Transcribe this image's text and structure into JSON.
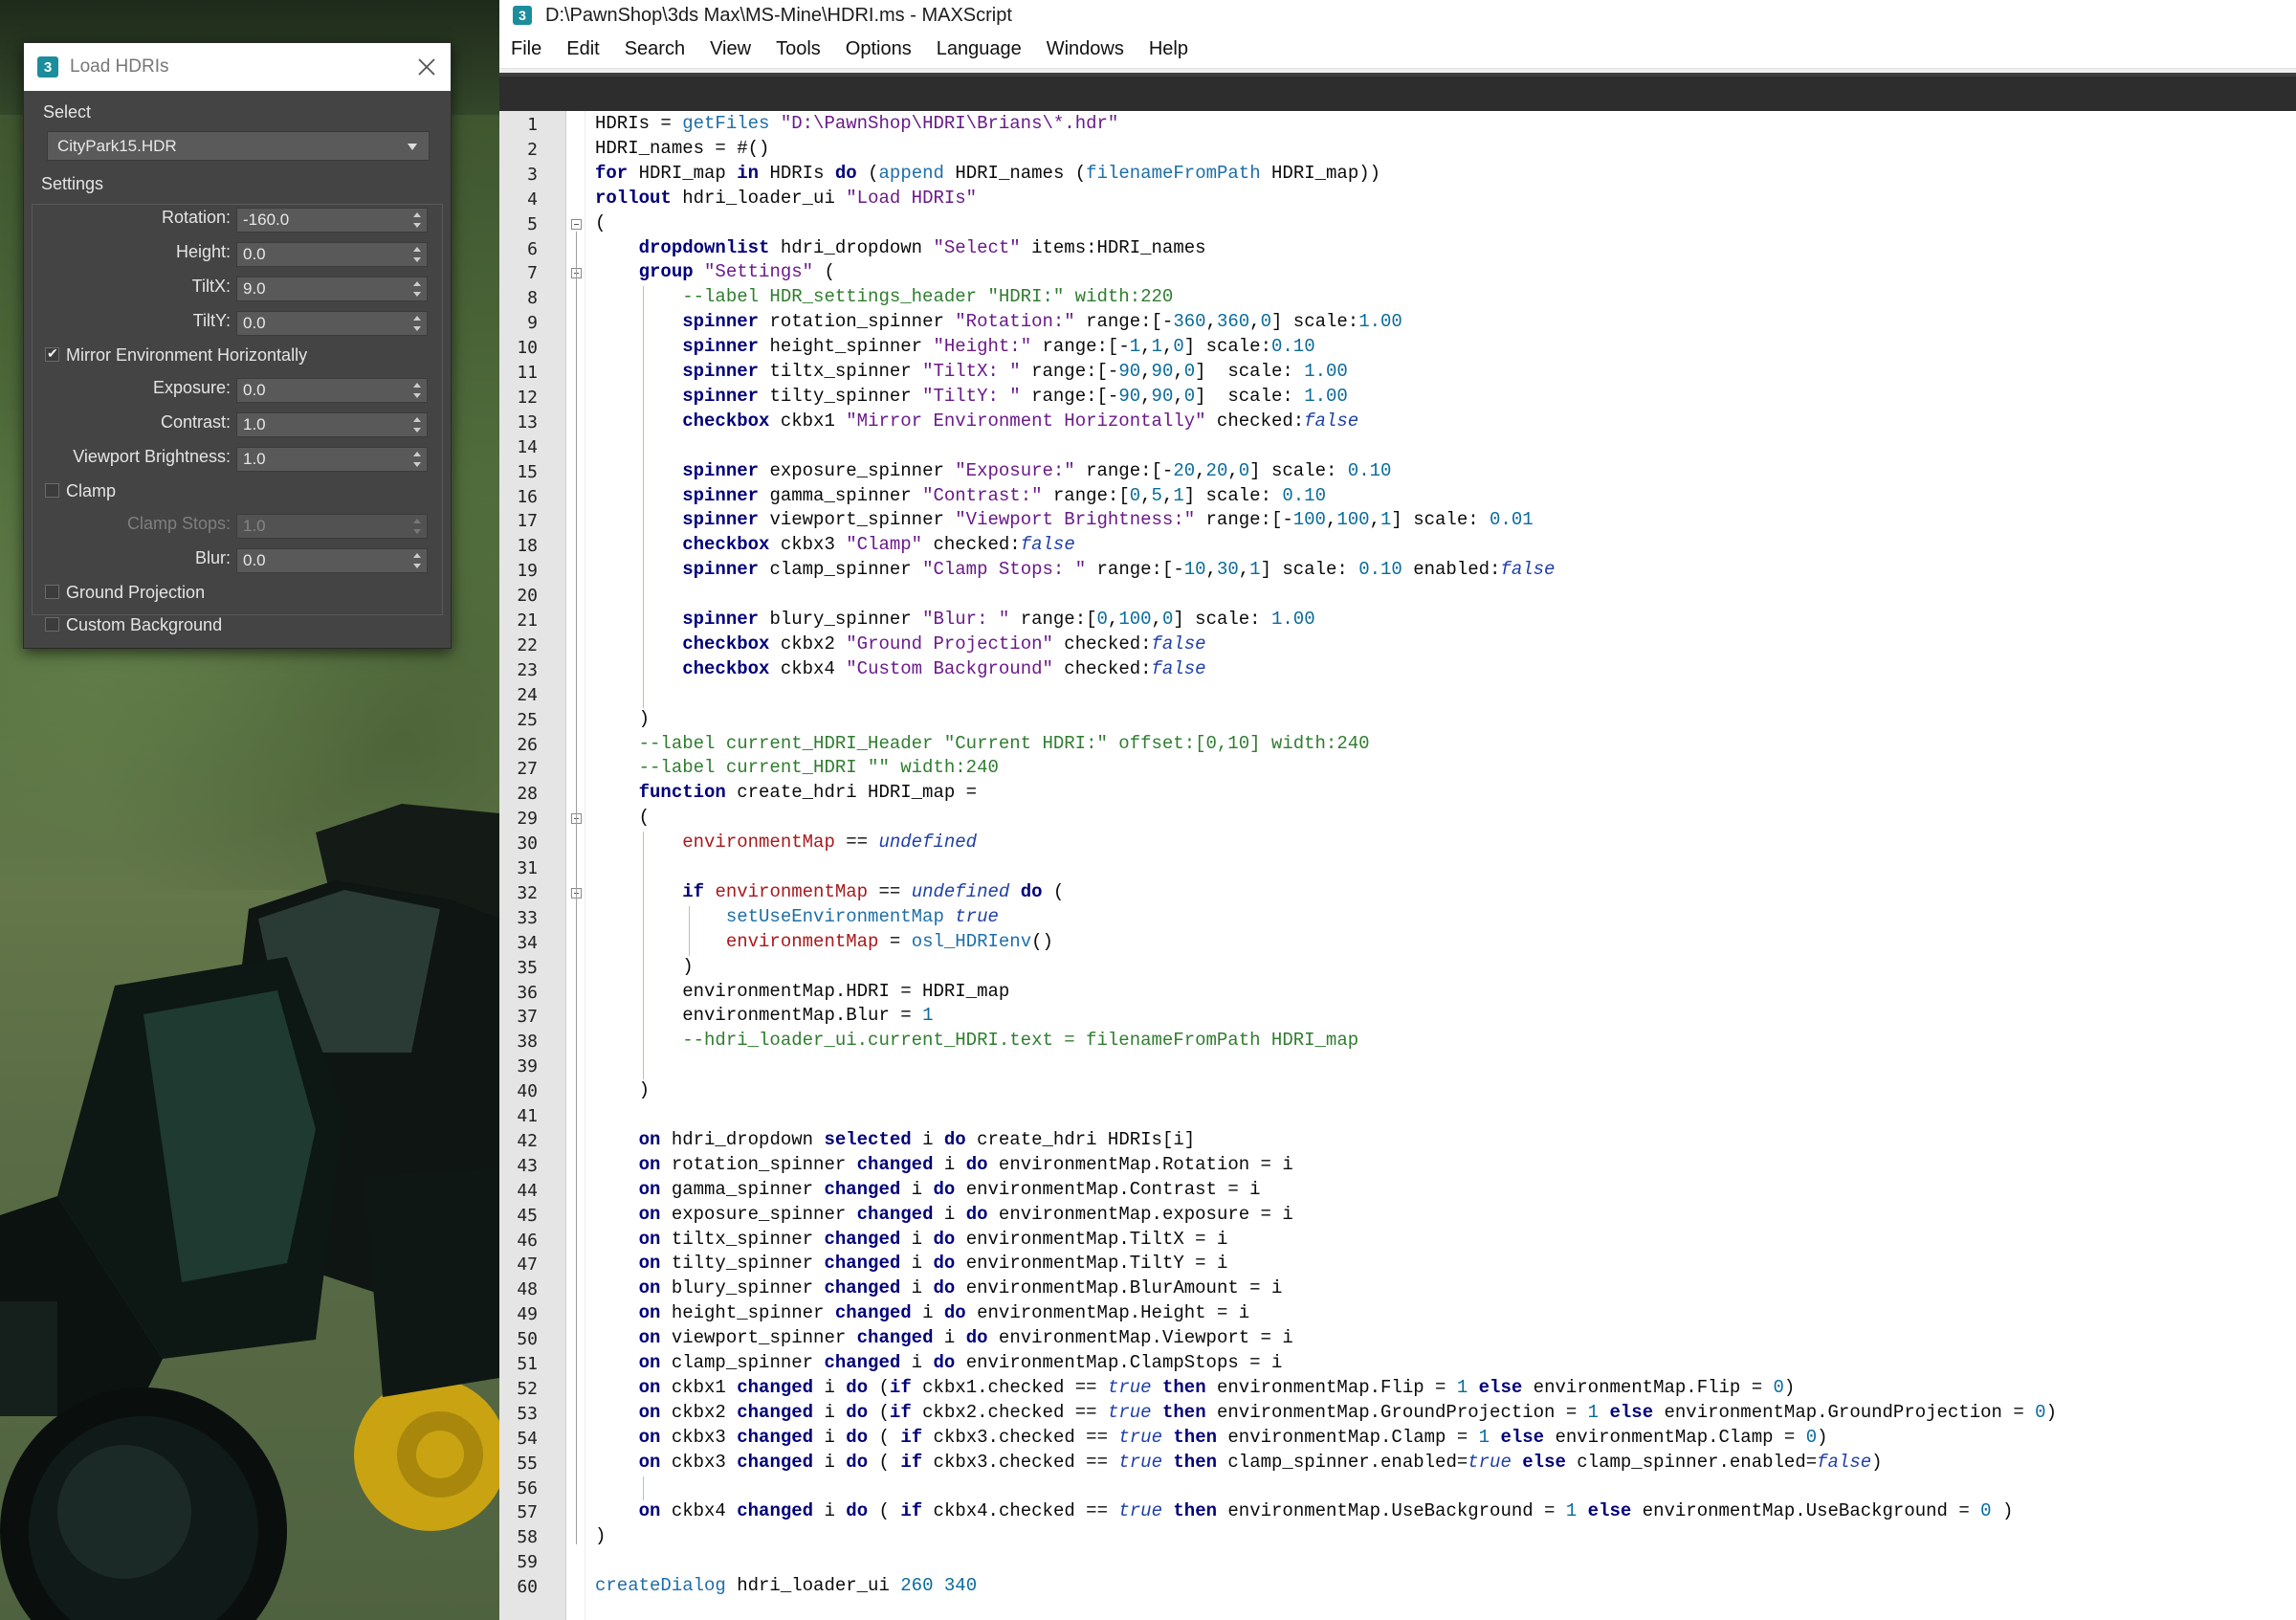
{
  "dialog": {
    "title": "Load HDRIs",
    "select_label": "Select",
    "selected_hdri": "CityPark15.HDR",
    "settings_label": "Settings",
    "rotation_label": "Rotation:",
    "rotation_value": "-160.0",
    "height_label": "Height:",
    "height_value": "0.0",
    "tiltx_label": "TiltX:",
    "tiltx_value": "9.0",
    "tilty_label": "TiltY:",
    "tilty_value": "0.0",
    "mirror_label": "Mirror Environment Horizontally",
    "mirror_checked": true,
    "exposure_label": "Exposure:",
    "exposure_value": "0.0",
    "contrast_label": "Contrast:",
    "contrast_value": "1.0",
    "viewport_label": "Viewport Brightness:",
    "viewport_value": "1.0",
    "clamp_label": "Clamp",
    "clamp_stops_label": "Clamp Stops:",
    "clamp_stops_value": "1.0",
    "blur_label": "Blur:",
    "blur_value": "0.0",
    "ground_label": "Ground Projection",
    "custom_bg_label": "Custom Background"
  },
  "editor": {
    "title": "D:\\PawnShop\\3ds Max\\MS-Mine\\HDRI.ms - MAXScript",
    "menu": [
      "File",
      "Edit",
      "Search",
      "View",
      "Tools",
      "Options",
      "Language",
      "Windows",
      "Help"
    ],
    "lines": [
      "HDRIs = getFiles \"D:\\PawnShop\\HDRI\\Brians\\*.hdr\"",
      "HDRI_names = #()",
      "for HDRI_map in HDRIs do (append HDRI_names (filenameFromPath HDRI_map))",
      "rollout hdri_loader_ui \"Load HDRIs\"",
      "(",
      "    dropdownlist hdri_dropdown \"Select\" items:HDRI_names",
      "    group \"Settings\" (",
      "        --label HDR_settings_header \"HDRI:\" width:220",
      "        spinner rotation_spinner \"Rotation:\" range:[-360,360,0] scale:1.00",
      "        spinner height_spinner \"Height:\" range:[-1,1,0] scale:0.10",
      "        spinner tiltx_spinner \"TiltX: \" range:[-90,90,0]  scale: 1.00",
      "        spinner tilty_spinner \"TiltY: \" range:[-90,90,0]  scale: 1.00",
      "        checkbox ckbx1 \"Mirror Environment Horizontally\" checked:false",
      "",
      "        spinner exposure_spinner \"Exposure:\" range:[-20,20,0] scale: 0.10",
      "        spinner gamma_spinner \"Contrast:\" range:[0,5,1] scale: 0.10",
      "        spinner viewport_spinner \"Viewport Brightness:\" range:[-100,100,1] scale: 0.01",
      "        checkbox ckbx3 \"Clamp\" checked:false",
      "        spinner clamp_spinner \"Clamp Stops: \" range:[-10,30,1] scale: 0.10 enabled:false",
      "",
      "        spinner blury_spinner \"Blur: \" range:[0,100,0] scale: 1.00",
      "        checkbox ckbx2 \"Ground Projection\" checked:false",
      "        checkbox ckbx4 \"Custom Background\" checked:false",
      "",
      "    )",
      "    --label current_HDRI_Header \"Current HDRI:\" offset:[0,10] width:240",
      "    --label current_HDRI \"\" width:240",
      "    function create_hdri HDRI_map =",
      "    (",
      "        environmentMap == undefined",
      "",
      "        if environmentMap == undefined do (",
      "            setUseEnvironmentMap true",
      "            environmentMap = osl_HDRIenv()",
      "        )",
      "        environmentMap.HDRI = HDRI_map",
      "        environmentMap.Blur = 1",
      "        --hdri_loader_ui.current_HDRI.text = filenameFromPath HDRI_map",
      "",
      "    )",
      "",
      "    on hdri_dropdown selected i do create_hdri HDRIs[i]",
      "    on rotation_spinner changed i do environmentMap.Rotation = i",
      "    on gamma_spinner changed i do environmentMap.Contrast = i",
      "    on exposure_spinner changed i do environmentMap.exposure = i",
      "    on tiltx_spinner changed i do environmentMap.TiltX = i",
      "    on tilty_spinner changed i do environmentMap.TiltY = i",
      "    on blury_spinner changed i do environmentMap.BlurAmount = i",
      "    on height_spinner changed i do environmentMap.Height = i",
      "    on viewport_spinner changed i do environmentMap.Viewport = i",
      "    on clamp_spinner changed i do environmentMap.ClampStops = i",
      "    on ckbx1 changed i do (if ckbx1.checked == true then environmentMap.Flip = 1 else environmentMap.Flip = 0)",
      "    on ckbx2 changed i do (if ckbx2.checked == true then environmentMap.GroundProjection = 1 else environmentMap.GroundProjection = 0)",
      "    on ckbx3 changed i do ( if ckbx3.checked == true then environmentMap.Clamp = 1 else environmentMap.Clamp = 0)",
      "    on ckbx3 changed i do ( if ckbx3.checked == true then clamp_spinner.enabled=true else clamp_spinner.enabled=false)",
      "",
      "    on ckbx4 changed i do ( if ckbx4.checked == true then environmentMap.UseBackground = 1 else environmentMap.UseBackground = 0 )",
      ")",
      "",
      "createDialog hdri_loader_ui 260 340"
    ]
  },
  "colors": {
    "keyword": "#00007a",
    "string": "#6a1a8a",
    "number": "#0a6b9a",
    "comment": "#2f7d2f",
    "global": "#a8181c",
    "accent_icon": "#1c8d9c"
  }
}
